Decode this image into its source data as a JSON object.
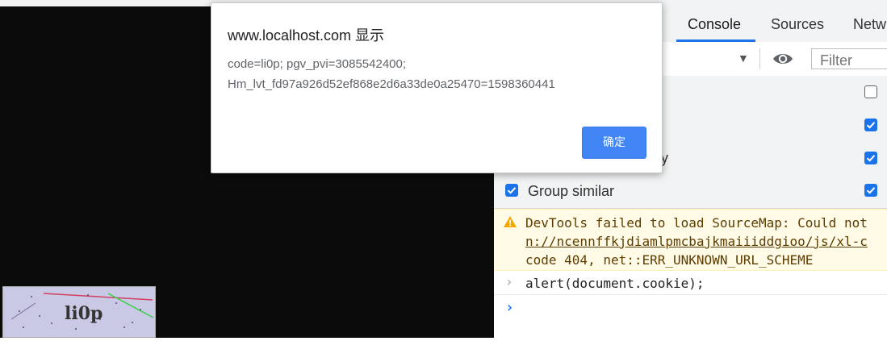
{
  "dialog": {
    "title": "www.localhost.com 显示",
    "message_line1": "code=li0p; pgv_pvi=3085542400;",
    "message_line2": "Hm_lvt_fd97a926d52ef868e2d6a33de0a25470=1598360441",
    "ok_label": "确定"
  },
  "captcha": {
    "text": "li0p"
  },
  "devtools": {
    "tabs": [
      {
        "label": "Console",
        "active": true
      },
      {
        "label": "Sources",
        "active": false
      },
      {
        "label": "Netw",
        "active": false
      }
    ],
    "toolbar": {
      "filter_placeholder": "Filter",
      "dropdown_glyph": "▼"
    },
    "settings": [
      {
        "label": "y",
        "checked": true
      },
      {
        "label": "Group similar",
        "checked": true
      }
    ],
    "right_checkboxes": [
      false,
      true,
      true,
      true
    ],
    "console": {
      "warning_lines": [
        "DevTools failed to load SourceMap: Could not",
        "n://ncennffkjdiamlpmcbajkmaiiiddgioo/js/xl-c",
        "code 404, net::ERR_UNKNOWN_URL_SCHEME"
      ],
      "command": "alert(document.cookie);",
      "prompt_glyph": "›"
    }
  },
  "colors": {
    "accent": "#1a73e8",
    "button": "#4285f4",
    "warning_bg": "#fffbe6",
    "warning_icon": "#f2a600"
  }
}
